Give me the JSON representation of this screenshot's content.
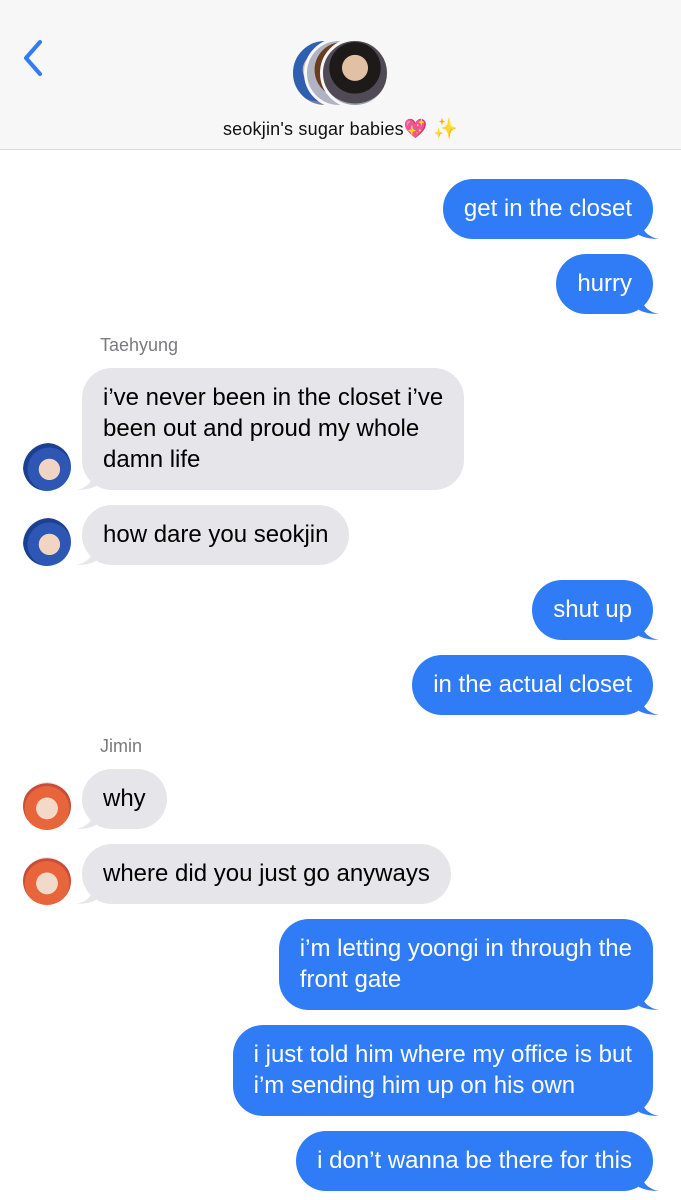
{
  "header": {
    "group_name": "seokjin's sugar babies",
    "emoji_heart": "💖",
    "emoji_sparkles": "✨",
    "back_icon": "chevron-left-icon"
  },
  "senders": {
    "taehyung": "Taehyung",
    "jimin": "Jimin"
  },
  "messages": [
    {
      "from": "me",
      "text": "get in the closet"
    },
    {
      "from": "me",
      "text": "hurry"
    },
    {
      "from": "Taehyung",
      "lines": [
        "i’ve never been in the closet i’ve",
        "been out and proud my whole",
        "damn life"
      ]
    },
    {
      "from": "Taehyung",
      "text": "how dare you seokjin"
    },
    {
      "from": "me",
      "text": "shut up"
    },
    {
      "from": "me",
      "text": "in the actual closet"
    },
    {
      "from": "Jimin",
      "text": "why"
    },
    {
      "from": "Jimin",
      "text": "where did you just go anyways"
    },
    {
      "from": "me",
      "lines": [
        "i’m letting yoongi in through the",
        "front gate"
      ]
    },
    {
      "from": "me",
      "lines": [
        "i just told him where my office is but",
        "i’m sending him up on his own"
      ]
    },
    {
      "from": "me",
      "text": "i don’t wanna be there for this"
    }
  ],
  "colors": {
    "outgoing": "#2f7cf6",
    "incoming": "#e6e5ea",
    "accent": "#2f7cf6"
  }
}
